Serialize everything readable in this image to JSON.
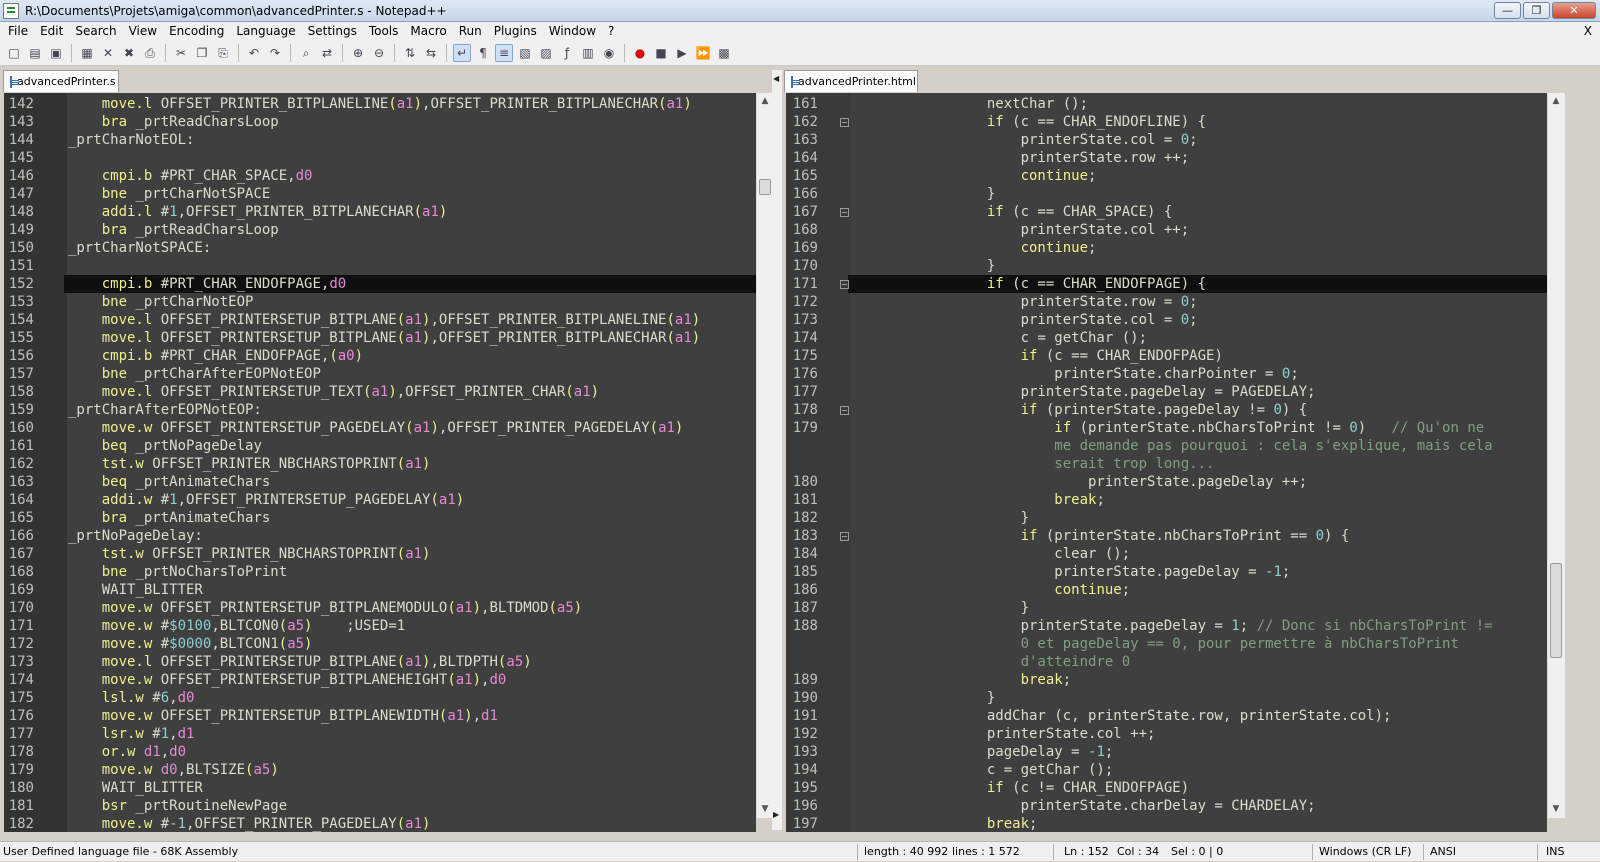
{
  "window": {
    "title": "R:\\Documents\\Projets\\amiga\\common\\advancedPrinter.s - Notepad++"
  },
  "menu": [
    "File",
    "Edit",
    "Search",
    "View",
    "Encoding",
    "Language",
    "Settings",
    "Tools",
    "Macro",
    "Run",
    "Plugins",
    "Window",
    "?"
  ],
  "menu_close": "X",
  "toolbar_icons": [
    "new-file-icon",
    "open-file-icon",
    "save-icon",
    "save-all-icon",
    "close-icon",
    "close-all-icon",
    "print-icon",
    "cut-icon",
    "copy-icon",
    "paste-icon",
    "undo-icon",
    "redo-icon",
    "find-icon",
    "replace-icon",
    "zoom-in-icon",
    "zoom-out-icon",
    "sync-v-icon",
    "sync-h-icon",
    "word-wrap-icon",
    "show-all-chars-icon",
    "indent-guide-icon",
    "udl-icon",
    "doc-map-icon",
    "function-list-icon",
    "folder-workspace-icon",
    "monitor-icon",
    "record-macro-icon",
    "stop-macro-icon",
    "play-macro-icon",
    "run-multiple-macro-icon",
    "save-macro-icon"
  ],
  "left_tab": "advancedPrinter.s",
  "right_tab": "advancedPrinter.html",
  "left_lines": [
    {
      "n": "142",
      "t": "    move.l OFFSET_PRINTER_BITPLANELINE(a1),OFFSET_PRINTER_BITPLANECHAR(a1)"
    },
    {
      "n": "143",
      "t": "    bra _prtReadCharsLoop"
    },
    {
      "n": "144",
      "t": "_prtCharNotEOL:"
    },
    {
      "n": "145",
      "t": ""
    },
    {
      "n": "146",
      "t": "    cmpi.b #PRT_CHAR_SPACE,d0"
    },
    {
      "n": "147",
      "t": "    bne _prtCharNotSPACE"
    },
    {
      "n": "148",
      "t": "    addi.l #1,OFFSET_PRINTER_BITPLANECHAR(a1)"
    },
    {
      "n": "149",
      "t": "    bra _prtReadCharsLoop"
    },
    {
      "n": "150",
      "t": "_prtCharNotSPACE:"
    },
    {
      "n": "151",
      "t": ""
    },
    {
      "n": "152",
      "t": "    cmpi.b #PRT_CHAR_ENDOFPAGE,d0",
      "cur": true
    },
    {
      "n": "153",
      "t": "    bne _prtCharNotEOP"
    },
    {
      "n": "154",
      "t": "    move.l OFFSET_PRINTERSETUP_BITPLANE(a1),OFFSET_PRINTER_BITPLANELINE(a1)"
    },
    {
      "n": "155",
      "t": "    move.l OFFSET_PRINTERSETUP_BITPLANE(a1),OFFSET_PRINTER_BITPLANECHAR(a1)"
    },
    {
      "n": "156",
      "t": "    cmpi.b #PRT_CHAR_ENDOFPAGE,(a0)"
    },
    {
      "n": "157",
      "t": "    bne _prtCharAfterEOPNotEOP"
    },
    {
      "n": "158",
      "t": "    move.l OFFSET_PRINTERSETUP_TEXT(a1),OFFSET_PRINTER_CHAR(a1)"
    },
    {
      "n": "159",
      "t": "_prtCharAfterEOPNotEOP:"
    },
    {
      "n": "160",
      "t": "    move.w OFFSET_PRINTERSETUP_PAGEDELAY(a1),OFFSET_PRINTER_PAGEDELAY(a1)"
    },
    {
      "n": "161",
      "t": "    beq _prtNoPageDelay"
    },
    {
      "n": "162",
      "t": "    tst.w OFFSET_PRINTER_NBCHARSTOPRINT(a1)"
    },
    {
      "n": "163",
      "t": "    beq _prtAnimateChars"
    },
    {
      "n": "164",
      "t": "    addi.w #1,OFFSET_PRINTERSETUP_PAGEDELAY(a1)"
    },
    {
      "n": "165",
      "t": "    bra _prtAnimateChars"
    },
    {
      "n": "166",
      "t": "_prtNoPageDelay:"
    },
    {
      "n": "167",
      "t": "    tst.w OFFSET_PRINTER_NBCHARSTOPRINT(a1)"
    },
    {
      "n": "168",
      "t": "    bne _prtNoCharsToPrint"
    },
    {
      "n": "169",
      "t": "    WAIT_BLITTER"
    },
    {
      "n": "170",
      "t": "    move.w OFFSET_PRINTERSETUP_BITPLANEMODULO(a1),BLTDMOD(a5)"
    },
    {
      "n": "171",
      "t": "    move.w #$0100,BLTCON0(a5)    ;USED=1"
    },
    {
      "n": "172",
      "t": "    move.w #$0000,BLTCON1(a5)"
    },
    {
      "n": "173",
      "t": "    move.l OFFSET_PRINTERSETUP_BITPLANE(a1),BLTDPTH(a5)"
    },
    {
      "n": "174",
      "t": "    move.w OFFSET_PRINTERSETUP_BITPLANEHEIGHT(a1),d0"
    },
    {
      "n": "175",
      "t": "    lsl.w #6,d0"
    },
    {
      "n": "176",
      "t": "    move.w OFFSET_PRINTERSETUP_BITPLANEWIDTH(a1),d1"
    },
    {
      "n": "177",
      "t": "    lsr.w #1,d1"
    },
    {
      "n": "178",
      "t": "    or.w d1,d0"
    },
    {
      "n": "179",
      "t": "    move.w d0,BLTSIZE(a5)"
    },
    {
      "n": "180",
      "t": "    WAIT_BLITTER"
    },
    {
      "n": "181",
      "t": "    bsr _prtRoutineNewPage"
    },
    {
      "n": "182",
      "t": "    move.w #-1,OFFSET_PRINTER_PAGEDELAY(a1)"
    }
  ],
  "right_lines": [
    {
      "n": "161",
      "t": "                nextChar ();"
    },
    {
      "n": "162",
      "t": "                if (c == CHAR_ENDOFLINE) {",
      "f": true
    },
    {
      "n": "163",
      "t": "                    printerState.col = 0;"
    },
    {
      "n": "164",
      "t": "                    printerState.row ++;"
    },
    {
      "n": "165",
      "t": "                    continue;"
    },
    {
      "n": "166",
      "t": "                }"
    },
    {
      "n": "167",
      "t": "                if (c == CHAR_SPACE) {",
      "f": true
    },
    {
      "n": "168",
      "t": "                    printerState.col ++;"
    },
    {
      "n": "169",
      "t": "                    continue;"
    },
    {
      "n": "170",
      "t": "                }"
    },
    {
      "n": "171",
      "t": "                if (c == CHAR_ENDOFPAGE) {",
      "f": true,
      "cur": true
    },
    {
      "n": "172",
      "t": "                    printerState.row = 0;"
    },
    {
      "n": "173",
      "t": "                    printerState.col = 0;"
    },
    {
      "n": "174",
      "t": "                    c = getChar ();"
    },
    {
      "n": "175",
      "t": "                    if (c == CHAR_ENDOFPAGE)"
    },
    {
      "n": "176",
      "t": "                        printerState.charPointer = 0;"
    },
    {
      "n": "177",
      "t": "                    printerState.pageDelay = PAGEDELAY;"
    },
    {
      "n": "178",
      "t": "                    if (printerState.pageDelay != 0) {",
      "f": true
    },
    {
      "n": "179",
      "t": "                        if (printerState.nbCharsToPrint != 0)   // Qu'on ne"
    },
    {
      "n": "",
      "t": "                        me demande pas pourquoi : cela s'explique, mais cela"
    },
    {
      "n": "",
      "t": "                        serait trop long..."
    },
    {
      "n": "180",
      "t": "                            printerState.pageDelay ++;"
    },
    {
      "n": "181",
      "t": "                        break;"
    },
    {
      "n": "182",
      "t": "                    }"
    },
    {
      "n": "183",
      "t": "                    if (printerState.nbCharsToPrint == 0) {",
      "f": true
    },
    {
      "n": "184",
      "t": "                        clear ();"
    },
    {
      "n": "185",
      "t": "                        printerState.pageDelay = -1;"
    },
    {
      "n": "186",
      "t": "                        continue;"
    },
    {
      "n": "187",
      "t": "                    }"
    },
    {
      "n": "188",
      "t": "                    printerState.pageDelay = 1; // Donc si nbCharsToPrint !="
    },
    {
      "n": "",
      "t": "                    0 et pageDelay == 0, pour permettre à nbCharsToPrint"
    },
    {
      "n": "",
      "t": "                    d'atteindre 0"
    },
    {
      "n": "189",
      "t": "                    break;"
    },
    {
      "n": "190",
      "t": "                }"
    },
    {
      "n": "191",
      "t": "                addChar (c, printerState.row, printerState.col);"
    },
    {
      "n": "192",
      "t": "                printerState.col ++;"
    },
    {
      "n": "193",
      "t": "                pageDelay = -1;"
    },
    {
      "n": "194",
      "t": "                c = getChar ();"
    },
    {
      "n": "195",
      "t": "                if (c != CHAR_ENDOFPAGE)"
    },
    {
      "n": "196",
      "t": "                    printerState.charDelay = CHARDELAY;"
    },
    {
      "n": "197",
      "t": "                break;"
    }
  ],
  "status": {
    "lang": "User Defined language file - 68K Assembly",
    "length": "length : 40 992",
    "lines": "lines : 1 572",
    "ln": "Ln : 152",
    "col": "Col : 34",
    "sel": "Sel : 0 | 0",
    "eol": "Windows (CR LF)",
    "enc": "ANSI",
    "mode": "INS"
  },
  "colors": {
    "editor_bg": "#3f3f3f",
    "current_line": "#0f0f0f",
    "keyword": "#efef8f",
    "register": "#e589d6",
    "number": "#8cd0d3",
    "comment": "#7f9f7f"
  }
}
